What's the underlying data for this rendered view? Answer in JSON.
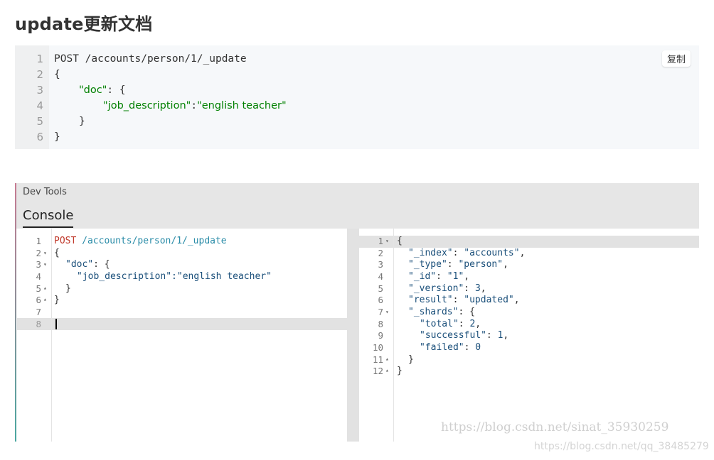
{
  "page": {
    "title": "update更新文档"
  },
  "code_block": {
    "copy_label": "复制",
    "line_numbers": [
      "1",
      "2",
      "3",
      "4",
      "5",
      "6"
    ],
    "lines": {
      "l1": "POST /accounts/person/1/_update",
      "l2": "{",
      "l3_key": "\"doc\"",
      "l3_rest": ": {",
      "l4_key": "\"job_description\"",
      "l4_sep": ":",
      "l4_val": "\"english teacher\"",
      "l5": "}",
      "l6": "}"
    }
  },
  "devtools": {
    "title": "Dev Tools",
    "tab": "Console",
    "request": {
      "line_numbers": [
        "1",
        "2",
        "3",
        "4",
        "5",
        "6",
        "7",
        "8"
      ],
      "method": "POST",
      "path": "/accounts/person/1/_update",
      "l2": "{",
      "l3_key": "\"doc\"",
      "l3_rest": ": {",
      "l4": "\"job_description\":\"english teacher\"",
      "l5": "}",
      "l6": "}"
    },
    "response": {
      "line_numbers": [
        "1",
        "2",
        "3",
        "4",
        "5",
        "6",
        "7",
        "8",
        "9",
        "10",
        "11",
        "12"
      ],
      "open": "{",
      "index_key": "\"_index\"",
      "index_val": "\"accounts\"",
      "type_key": "\"_type\"",
      "type_val": "\"person\"",
      "id_key": "\"_id\"",
      "id_val": "\"1\"",
      "version_key": "\"_version\"",
      "version_val": "3",
      "result_key": "\"result\"",
      "result_val": "\"updated\"",
      "shards_key": "\"_shards\"",
      "total_key": "\"total\"",
      "total_val": "2",
      "successful_key": "\"successful\"",
      "successful_val": "1",
      "failed_key": "\"failed\"",
      "failed_val": "0",
      "close_inner": "}",
      "close": "}"
    }
  },
  "watermarks": {
    "primary": "https://blog.csdn.net/sinat_35930259",
    "secondary": "https://blog.csdn.net/qq_38485279"
  }
}
